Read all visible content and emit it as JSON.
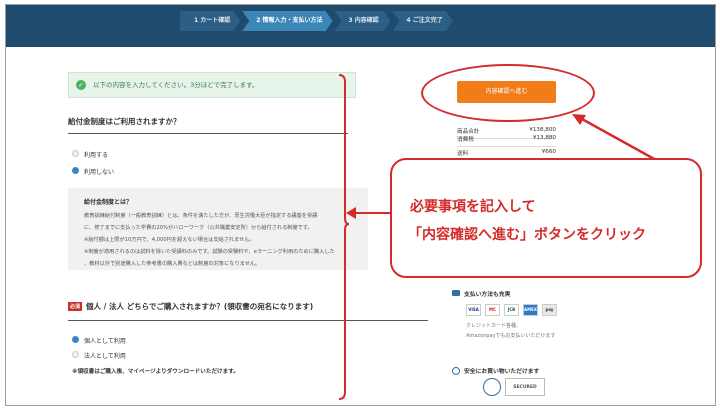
{
  "steps": [
    {
      "label": "1 カート確認"
    },
    {
      "label": "2 情報入力・支払い方法"
    },
    {
      "label": "3 内容確認"
    },
    {
      "label": "4 ご注文完了"
    }
  ],
  "notice": {
    "text": "以下の内容を入力してください。3分ほどで完了します。"
  },
  "cta": {
    "label": "内容確認へ進む"
  },
  "summary": [
    {
      "label": "商品合計",
      "value": "¥138,800"
    },
    {
      "label": "消費税",
      "value": "¥13,880"
    },
    {
      "label": "送料",
      "value": "¥660"
    }
  ],
  "callout": {
    "line1": "必要事項を記入して",
    "line2": "「内容確認へ進む」ボタンをクリック"
  },
  "grant": {
    "heading": "給付金制度はご利用されますか？",
    "options": [
      {
        "label": "利用する",
        "selected": false
      },
      {
        "label": "利用しない",
        "selected": true
      }
    ],
    "info": {
      "title": "給付金制度とは？",
      "lines": [
        "教育訓練給付制度（一般教育訓練）とは、条件を満たした方が、厚生労働大臣が指定する講座を受講",
        "に、修了までに支払った学費の20%がハローワーク（公共職業安定所）から給付される制度です。",
        "※給付額は上限が10万円で、4,000円を超えない場合は支給されません。",
        "※制度が適用されるのは試料を除いた受講料のみです。試験の受験料や、eラーニング利用のために購入した",
        "、教材以外で別途購入した参考書の購入費などは制度の対象になりません。"
      ]
    }
  },
  "buyer": {
    "required": "必須",
    "heading": "個人 / 法人 どちらでご購入されますか？(領収書の宛名になります)",
    "options": [
      {
        "label": "個人として利用",
        "selected": true
      },
      {
        "label": "法人として利用",
        "selected": false
      }
    ],
    "note": "※領収書はご購入後、マイページよりダウンロードいただけます。"
  },
  "payment": {
    "heading": "支払い方法も充実",
    "cards": [
      "VISA",
      "MC",
      "JCB",
      "AMEX",
      "pay"
    ],
    "desc1": "クレジットカード各種、",
    "desc2": "Amazonpayでもお支払いいただけます"
  },
  "secure": {
    "heading": "安全にお買い物いただけます",
    "badge": "SECURED"
  },
  "colors": {
    "accent": "#f07d1a",
    "annotation": "#d42a2a",
    "header": "#1f4c6e"
  }
}
